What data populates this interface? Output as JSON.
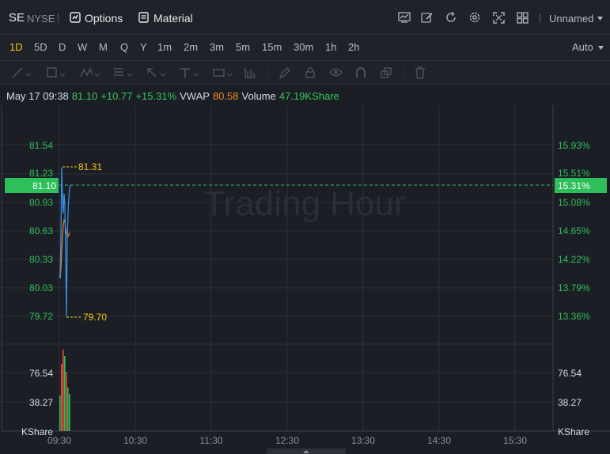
{
  "header": {
    "symbol": "SE",
    "exchange": "NYSE",
    "options_label": "Options",
    "material_label": "Material",
    "layout_name": "Unnamed"
  },
  "periods": [
    "1D",
    "5D",
    "D",
    "W",
    "M",
    "Q",
    "Y",
    "1m",
    "2m",
    "3m",
    "5m",
    "15m",
    "30m",
    "1h",
    "2h"
  ],
  "active_period": "1D",
  "scale_mode": "Auto",
  "info": {
    "datetime": "May 17 09:38",
    "price": "81.10",
    "change": "+10.77",
    "change_pct": "+15.31%",
    "vwap_label": "VWAP",
    "vwap": "80.58",
    "volume_label": "Volume",
    "volume": "47.19KShare"
  },
  "watermark": "Trading Hour",
  "price_axis_left": [
    "81.54",
    "81.23",
    "80.93",
    "80.63",
    "80.33",
    "80.03",
    "79.72"
  ],
  "pct_axis_right": [
    "15.93%",
    "15.51%",
    "15.08%",
    "14.65%",
    "14.22%",
    "13.79%",
    "13.36%"
  ],
  "current": {
    "price": "81.10",
    "pct": "15.31%"
  },
  "high_marker": "81.31",
  "low_marker": "79.70",
  "volume_axis_left": [
    "76.54",
    "38.27",
    "KShare"
  ],
  "volume_axis_right": [
    "76.54",
    "38.27",
    "KShare"
  ],
  "time_axis": [
    "09:30",
    "10:30",
    "11:30",
    "12:30",
    "13:30",
    "14:30",
    "15:30"
  ],
  "colors": {
    "up": "#34c759",
    "vwap": "#f08a24",
    "price_line": "#3a8ee6",
    "marker": "#f5c518",
    "current_tag": "#2fbf5a"
  }
}
